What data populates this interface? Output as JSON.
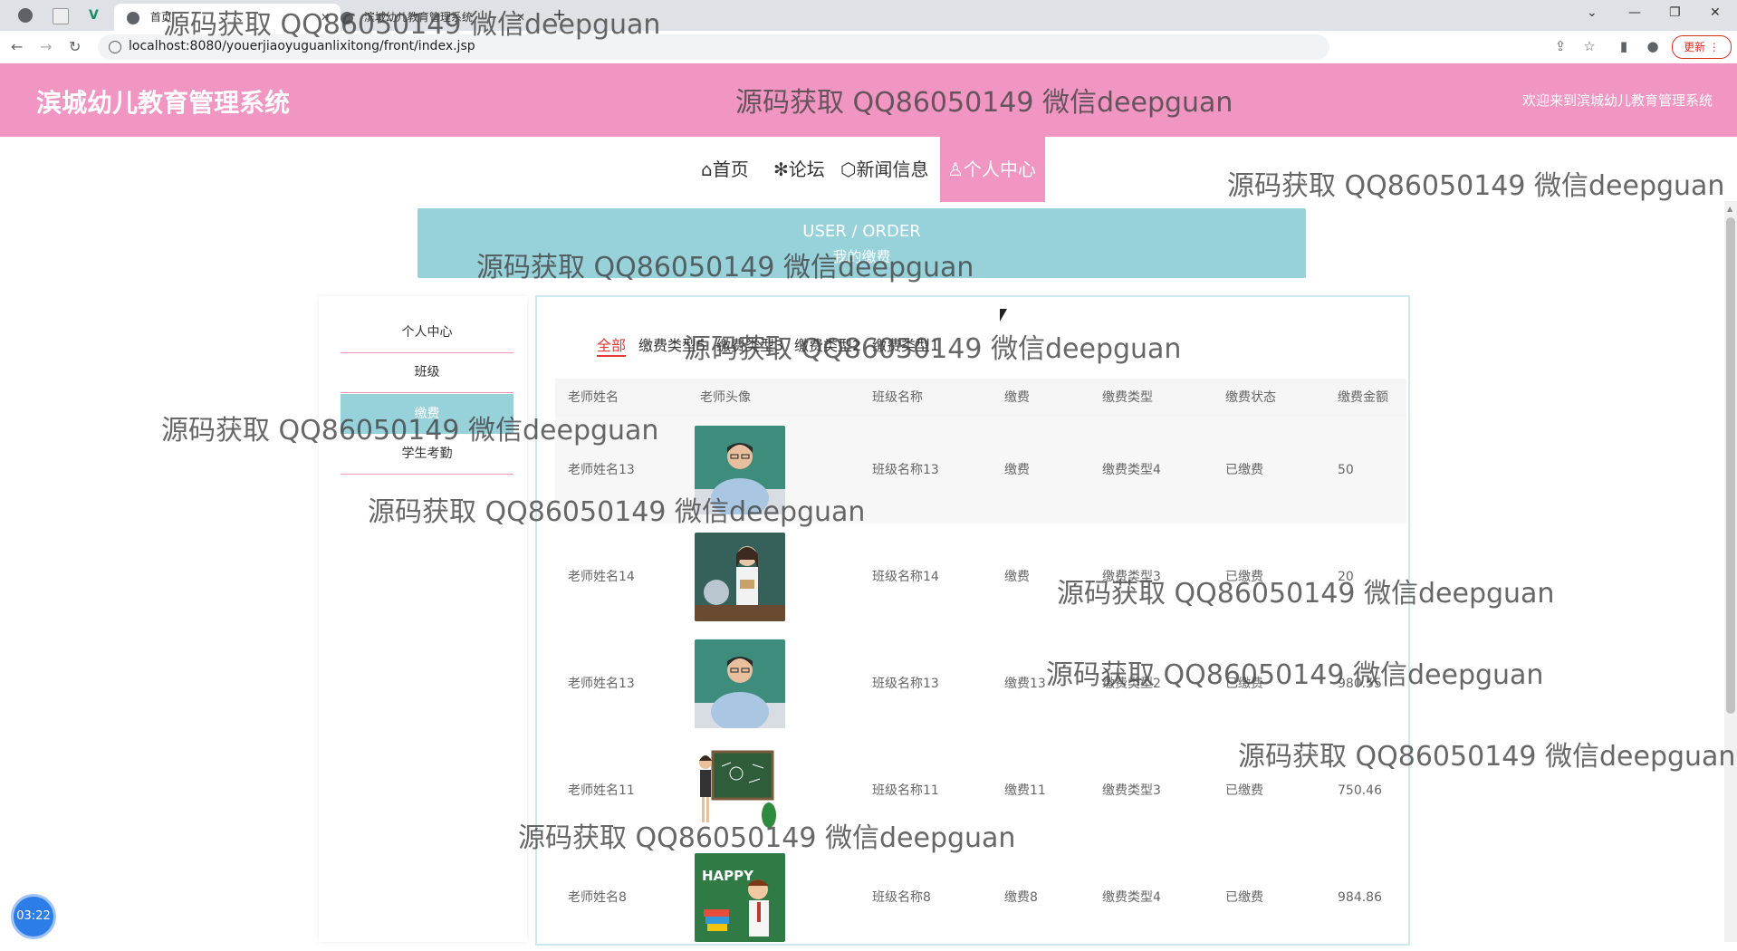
{
  "browser": {
    "tabs": [
      {
        "label": "首页",
        "active": true
      },
      {
        "label": "滨城幼儿教育管理系统",
        "active": false
      }
    ],
    "new_tab_symbol": "+",
    "close_symbol": "✕",
    "url": "localhost:8080/youerjiaoyuguanlixitong/front/index.jsp",
    "update_label": "更新 ⋮",
    "window_controls": [
      "⌄",
      "—",
      "❐",
      "✕"
    ],
    "icons": [
      "back-icon",
      "forward-icon",
      "reload-icon",
      "info-icon",
      "share-icon",
      "star-icon",
      "sidepanel-icon",
      "profile-icon"
    ]
  },
  "site": {
    "title": "滨城幼儿教育管理系统",
    "welcome": "欢迎来到滨城幼儿教育管理系统",
    "accent_color": "#f195c2",
    "secondary_color": "#97d2da"
  },
  "nav": {
    "items": [
      {
        "icon": "⌂",
        "label": "⌂首页"
      },
      {
        "icon": "✻",
        "label": "✻论坛"
      },
      {
        "icon": "⬡",
        "label": "⬡新闻信息"
      },
      {
        "icon": "♙",
        "label": "♙个人中心"
      }
    ],
    "active_index": 3
  },
  "banner": {
    "title": "USER / ORDER",
    "subtitle": "我的缴费"
  },
  "sidebar": {
    "items": [
      "个人中心",
      "班级",
      "缴费",
      "学生考勤"
    ],
    "active_index": 2
  },
  "filters": {
    "items": [
      "全部",
      "缴费类型5",
      "缴费类型3",
      "缴费类型2",
      "缴费类型1"
    ],
    "active_index": 0
  },
  "table": {
    "headers": [
      "老师姓名",
      "老师头像",
      "班级名称",
      "缴费",
      "缴费类型",
      "缴费状态",
      "缴费金额"
    ],
    "rows": [
      {
        "teacher": "老师姓名13",
        "avatar": "teacher-male-photo",
        "class": "班级名称13",
        "fee": "缴费",
        "type": "缴费类型4",
        "status": "已缴费",
        "amount": "50"
      },
      {
        "teacher": "老师姓名14",
        "avatar": "teacher-female-photo",
        "class": "班级名称14",
        "fee": "缴费",
        "type": "缴费类型3",
        "status": "已缴费",
        "amount": "20"
      },
      {
        "teacher": "老师姓名13",
        "avatar": "teacher-male-photo",
        "class": "班级名称13",
        "fee": "缴费13",
        "type": "缴费类型2",
        "status": "已缴费",
        "amount": "980.55"
      },
      {
        "teacher": "老师姓名11",
        "avatar": "teacher-chalkboard-cartoon",
        "class": "班级名称11",
        "fee": "缴费11",
        "type": "缴费类型3",
        "status": "已缴费",
        "amount": "750.46"
      },
      {
        "teacher": "老师姓名8",
        "avatar": "teachers-day-cartoon",
        "class": "班级名称8",
        "fee": "缴费8",
        "type": "缴费类型4",
        "status": "已缴费",
        "amount": "984.86"
      }
    ]
  },
  "timer": "03:22",
  "watermark": "源码获取 QQ86050149 微信deepguan"
}
